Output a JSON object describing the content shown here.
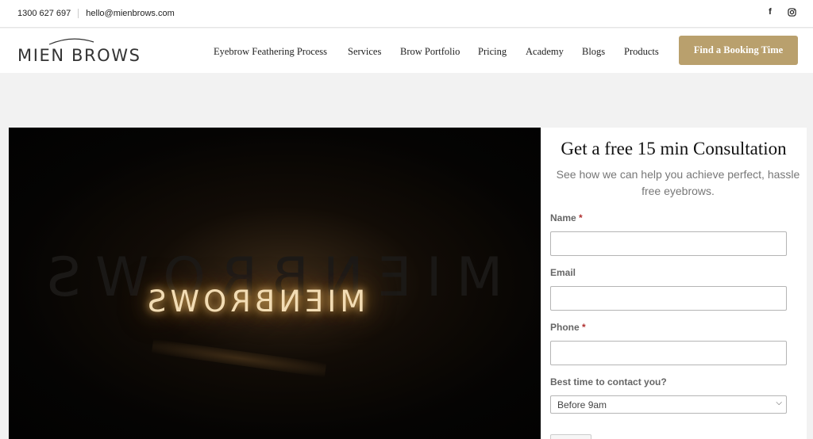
{
  "topbar": {
    "phone": "1300 627 697",
    "email": "hello@mienbrows.com",
    "social": [
      {
        "icon": "facebook-icon",
        "glyph": "f"
      },
      {
        "icon": "instagram-icon"
      }
    ]
  },
  "header": {
    "logo_text": "MIEN BROWS",
    "nav": [
      "Eyebrow Feathering Process",
      "Services",
      "Brow Portfolio",
      "Pricing",
      "Academy",
      "Blogs",
      "Products"
    ],
    "cta_label": "Find a Booking Time",
    "cta_color": "#b9a06d"
  },
  "video": {
    "overlay_text": "MIENBROWS"
  },
  "form": {
    "title": "Get a free 15 min Consultation",
    "subtitle": "See how we can help you achieve perfect, hassle free eyebrows.",
    "fields": {
      "name_label": "Name",
      "email_label": "Email",
      "phone_label": "Phone",
      "required_mark": "*",
      "contact_time_label": "Best time to contact you?",
      "contact_time_value": "Before 9am"
    }
  }
}
